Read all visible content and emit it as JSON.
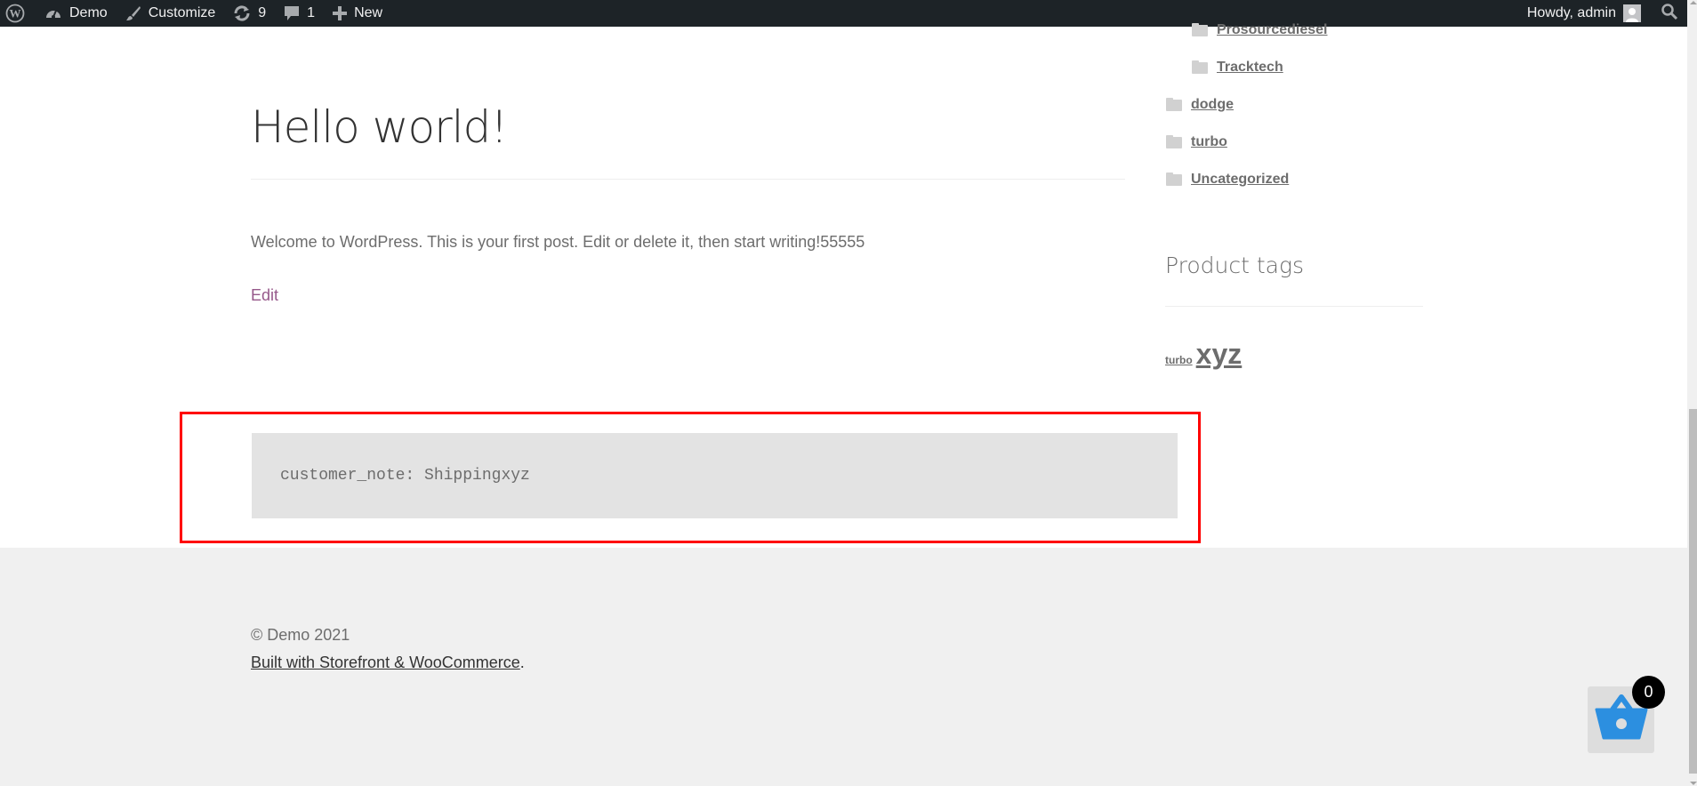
{
  "adminbar": {
    "site_name": "Demo",
    "customize_label": "Customize",
    "updates_count": "9",
    "comments_count": "1",
    "new_label": "New",
    "howdy_label": "Howdy, admin"
  },
  "post": {
    "title": "Hello world!",
    "body": "Welcome to WordPress. This is your first post. Edit or delete it, then start writing!55555",
    "edit_label": "Edit",
    "note": "customer_note: Shippingxyz"
  },
  "sidebar": {
    "categories": [
      {
        "label": "Prosourcediesel",
        "level": 2
      },
      {
        "label": "Tracktech",
        "level": 2
      },
      {
        "label": "dodge",
        "level": 1
      },
      {
        "label": "turbo",
        "level": 1
      },
      {
        "label": "Uncategorized",
        "level": 1
      }
    ],
    "product_tags_title": "Product tags",
    "tags": [
      {
        "label": "turbo",
        "size": "small"
      },
      {
        "label": "xyz",
        "size": "large"
      }
    ]
  },
  "footer": {
    "copyright": "© Demo 2021",
    "built_with_link": "Built with Storefront & WooCommerce",
    "built_with_suffix": "."
  },
  "cart": {
    "count": "0"
  },
  "colors": {
    "adminbar_bg": "#1d2327",
    "link_accent": "#96588a",
    "cart_icon": "#2c8fe0",
    "highlight_border": "#ff0000"
  }
}
